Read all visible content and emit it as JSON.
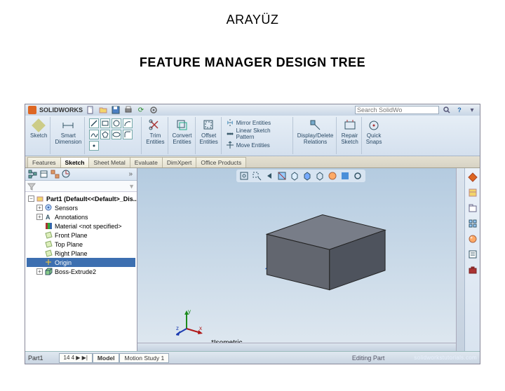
{
  "page": {
    "title": "ARAYÜZ",
    "subtitle": "FEATURE MANAGER  DESIGN TREE"
  },
  "titlebar": {
    "app_name": "SOLIDWORKS",
    "search_placeholder": "Search SolidWo",
    "help_glyph": "?"
  },
  "ribbon": {
    "g1_label": "Sketch",
    "g2_label": "Smart\nDimension",
    "g4_label": "Trim\nEntities",
    "g5_label": "Convert\nEntities",
    "g6_label": "Offset\nEntities",
    "g7_line1": "Mirror Entities",
    "g7_line2": "Linear Sketch Pattern",
    "g7_line3": "Move Entities",
    "g8_label": "Display/Delete\nRelations",
    "g9_label": "Repair\nSketch",
    "g10_label": "Quick\nSnaps"
  },
  "cm_tabs": {
    "t1": "Features",
    "t2": "Sketch",
    "t3": "Sheet Metal",
    "t4": "Evaluate",
    "t5": "DimXpert",
    "t6": "Office Products"
  },
  "fm": {
    "filter_glyph": "▼",
    "root": "Part1 (Default<<Default>_Dis...",
    "sensors": "Sensors",
    "annotations": "Annotations",
    "material": "Material <not specified>",
    "front": "Front Plane",
    "top": "Top Plane",
    "right": "Right Plane",
    "origin": "Origin",
    "extrude": "Boss-Extrude2"
  },
  "viewport": {
    "view_label": "*Isometric",
    "triad_x": "x",
    "triad_y": "y",
    "triad_z": "z"
  },
  "status": {
    "doc_tab1": "Part1",
    "doc_tab1b": "14 4 ▶ ▶|",
    "doc_tab2": "Model",
    "doc_tab3": "Motion Study 1",
    "editing": "Editing Part",
    "watermark": "solidworkstutorials.com"
  },
  "colors": {
    "accent": "#3d6fb0"
  }
}
